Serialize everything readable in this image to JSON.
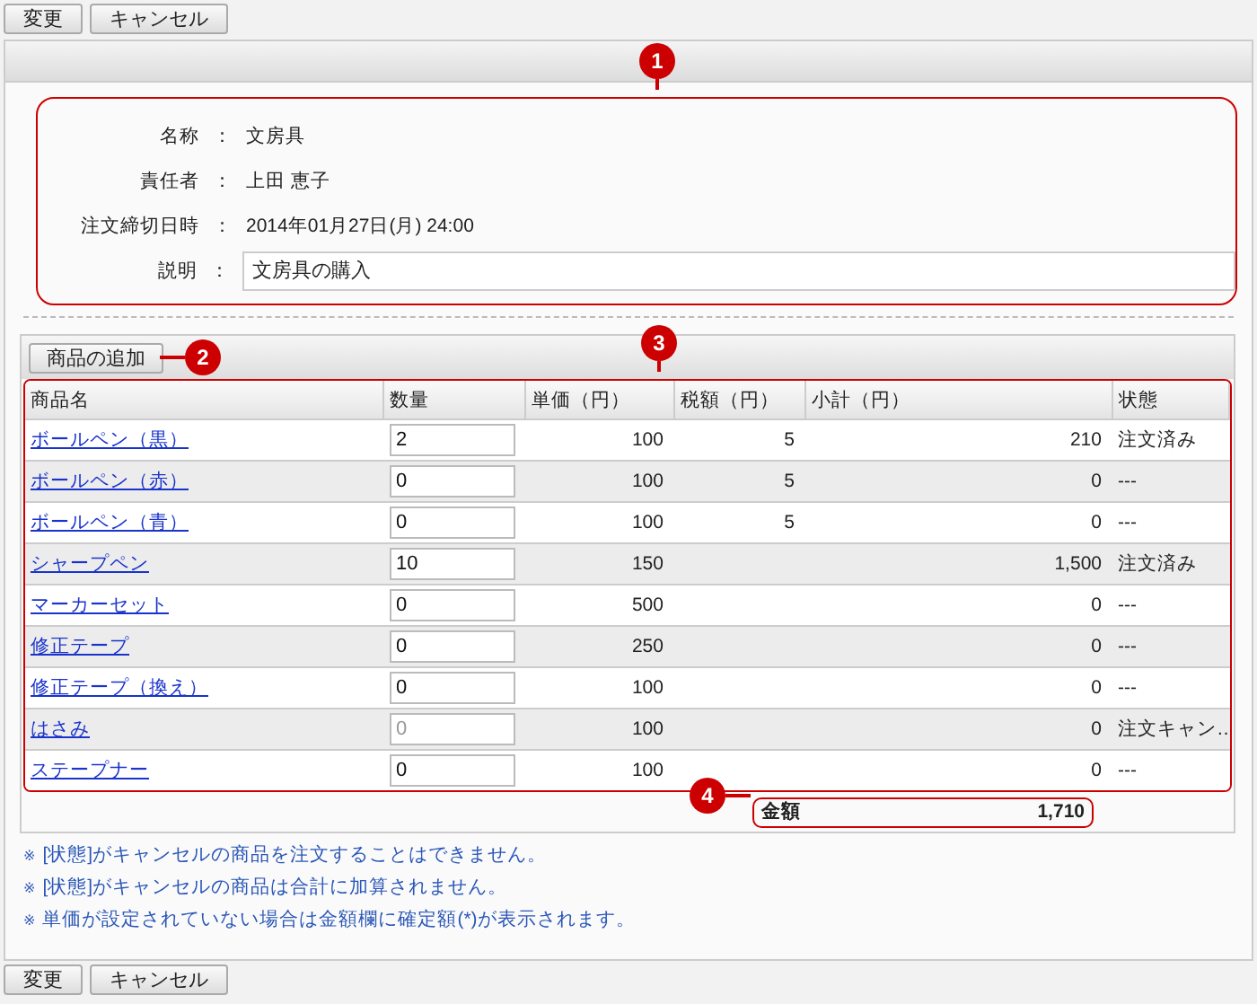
{
  "top_buttons": [
    "変更",
    "キャンセル"
  ],
  "callouts": [
    "1",
    "2",
    "3",
    "4"
  ],
  "form": [
    {
      "label": "名称",
      "separator": "：",
      "value": "文房具",
      "kind": "text"
    },
    {
      "label": "責任者",
      "separator": "：",
      "value": "上田 恵子",
      "kind": "text"
    },
    {
      "label": "注文締切日時",
      "separator": "：",
      "value": "2014年01月27日(月) 24:00",
      "kind": "text"
    },
    {
      "label": "説明",
      "separator": "：",
      "value": "文房具の購入",
      "kind": "field"
    }
  ],
  "add_button": "商品の追加",
  "table": {
    "columns": [
      "商品名",
      "数量",
      "単価（円）",
      "税額（円）",
      "小計（円）",
      "状態"
    ],
    "rows": [
      {
        "name": "ボールペン（黒）",
        "quantity": "2",
        "disabled": false,
        "price": "100",
        "tax": "5",
        "subtotal": "210",
        "status": "注文済み"
      },
      {
        "name": "ボールペン（赤）",
        "quantity": "0",
        "disabled": false,
        "price": "100",
        "tax": "5",
        "subtotal": "0",
        "status": "---"
      },
      {
        "name": "ボールペン（青）",
        "quantity": "0",
        "disabled": false,
        "price": "100",
        "tax": "5",
        "subtotal": "0",
        "status": "---"
      },
      {
        "name": "シャープペン",
        "quantity": "10",
        "disabled": false,
        "price": "150",
        "tax": "",
        "subtotal": "1,500",
        "status": "注文済み"
      },
      {
        "name": "マーカーセット",
        "quantity": "0",
        "disabled": false,
        "price": "500",
        "tax": "",
        "subtotal": "0",
        "status": "---"
      },
      {
        "name": "修正テープ",
        "quantity": "0",
        "disabled": false,
        "price": "250",
        "tax": "",
        "subtotal": "0",
        "status": "---"
      },
      {
        "name": "修正テープ（換え）",
        "quantity": "0",
        "disabled": false,
        "price": "100",
        "tax": "",
        "subtotal": "0",
        "status": "---"
      },
      {
        "name": "はさみ",
        "quantity": "0",
        "disabled": true,
        "price": "100",
        "tax": "",
        "subtotal": "0",
        "status": "注文キャン…"
      },
      {
        "name": "ステープナー",
        "quantity": "0",
        "disabled": false,
        "price": "100",
        "tax": "",
        "subtotal": "0",
        "status": "---"
      }
    ]
  },
  "total": {
    "label": "金額",
    "value": "1,710"
  },
  "notes": [
    {
      "mark": "※",
      "text": "[状態]がキャンセルの商品を注文することはできません。"
    },
    {
      "mark": "※",
      "text": "[状態]がキャンセルの商品は合計に加算されません。"
    },
    {
      "mark": "※",
      "text": "単価が設定されていない場合は金額欄に確定額(*)が表示されます。"
    }
  ],
  "bottom_buttons": [
    "変更",
    "キャンセル"
  ]
}
